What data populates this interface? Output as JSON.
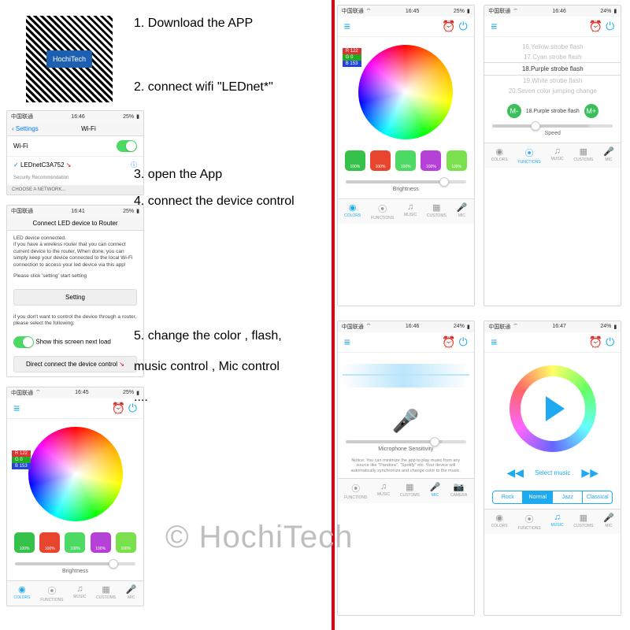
{
  "watermark": "© HochiTech",
  "qr_brand": "HochiTech",
  "instructions": {
    "i1": "1. Download the APP",
    "i2": "2. connect wifi   \"LEDnet*\"",
    "i3": "3. open the App",
    "i4": "4. connect the device control",
    "i5": "5. change the color , flash,",
    "i5b": "music control , Mic control",
    "i5c": "...."
  },
  "status": {
    "carrier": "中国联通",
    "wifi_icon": "⌔",
    "time1": "16:46",
    "time2": "16:41",
    "time3": "16:45",
    "time4": "16:47",
    "batt": "25%",
    "batt2": "24%"
  },
  "wifi_screen": {
    "back": "Settings",
    "title": "Wi-Fi",
    "wifi_label": "Wi-Fi",
    "network": "LEDnetC3A752",
    "network_sub": "Security Recommendation",
    "choose": "CHOOSE A NETWORK..."
  },
  "router_screen": {
    "title": "Connect LED device to Router",
    "para1": "LED device connected.\nif you have a wireless router that you can connect current device to the router, When done, you can simply keep your device connected to the local Wi-Fi connection to access your led device via this app!",
    "para2": "Please click 'setting' start setting",
    "setting_btn": "Setting",
    "para3": "if you don't want to control the device through a router, please select the following:",
    "show_next": "Show this screen next load",
    "direct_btn": "Direct connect the device control"
  },
  "rgb": {
    "r": "R 122",
    "g": "G 0",
    "b": "B 153"
  },
  "swatches": [
    {
      "color": "#36c24a",
      "label": "100%"
    },
    {
      "color": "#e8452f",
      "label": "100%"
    },
    {
      "color": "#4cd964",
      "label": "100%"
    },
    {
      "color": "#b541d6",
      "label": "100%"
    },
    {
      "color": "#7be04e",
      "label": "100%"
    }
  ],
  "brightness_label": "Brightness",
  "tabs": {
    "colors": "COLORS",
    "functions": "FUNCTIONS",
    "music": "MUSIC",
    "customs": "CUSTOMS",
    "mic": "MIC",
    "camera": "CAMERA"
  },
  "fx": {
    "items": [
      {
        "n": "16",
        "t": "Yellow strobe flash"
      },
      {
        "n": "17",
        "t": "Cyan strobe flash"
      },
      {
        "n": "18",
        "t": "Purple strobe flash"
      },
      {
        "n": "19",
        "t": "White strobe flash"
      },
      {
        "n": "20",
        "t": "Seven color jumping change"
      }
    ],
    "selected_idx": 2,
    "current": "18.Purple strobe flash",
    "speed_label": "Speed",
    "minus": "M-",
    "plus": "M+"
  },
  "mic": {
    "label": "Microphone Sensitivity",
    "notice": "Notice: You can minimize the app to play music from any source like \"Pandora\", \"Spotify\" etc. Your device will automatically synchronize and change color to the music."
  },
  "music": {
    "select": "Select music",
    "prev": "◀◀",
    "next": "▶▶",
    "genres": [
      "Rock",
      "Normal",
      "Jazz",
      "Classical"
    ],
    "genre_active": 1
  },
  "header_icons": {
    "menu": "≡",
    "clock": "⏰",
    "power": "⏻"
  }
}
